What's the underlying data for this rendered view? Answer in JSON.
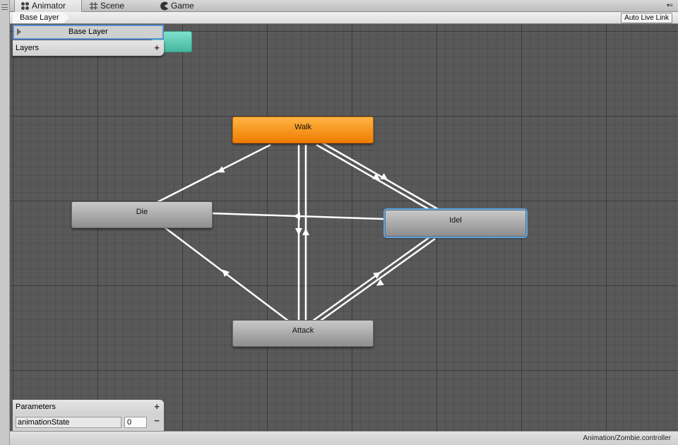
{
  "tabs": [
    {
      "label": "Animator",
      "icon": "animator-icon",
      "active": true
    },
    {
      "label": "Scene",
      "icon": "scene-grid-icon",
      "active": false
    },
    {
      "label": "Game",
      "icon": "game-pacman-icon",
      "active": false
    }
  ],
  "toolbar": {
    "breadcrumb": "Base Layer",
    "live_link_label": "Auto Live Link"
  },
  "layers_panel": {
    "title": "Layers",
    "add_label": "+",
    "items": [
      {
        "label": "Base Layer"
      }
    ]
  },
  "states": [
    {
      "id": "walk",
      "label": "Walk",
      "default": true,
      "selected": false
    },
    {
      "id": "die",
      "label": "Die",
      "default": false,
      "selected": false
    },
    {
      "id": "idel",
      "label": "Idel",
      "default": false,
      "selected": true
    },
    {
      "id": "attack",
      "label": "Attack",
      "default": false,
      "selected": false
    }
  ],
  "parameters_panel": {
    "title": "Parameters",
    "add_label": "+",
    "remove_label": "−",
    "items": [
      {
        "name": "animationState",
        "value": "0"
      }
    ]
  },
  "statusbar": {
    "path": "Animation/Zombie.controller"
  },
  "colors": {
    "default_state": "#ef7c00",
    "any_state": "#45b69f",
    "selection": "#5aa7e8"
  }
}
